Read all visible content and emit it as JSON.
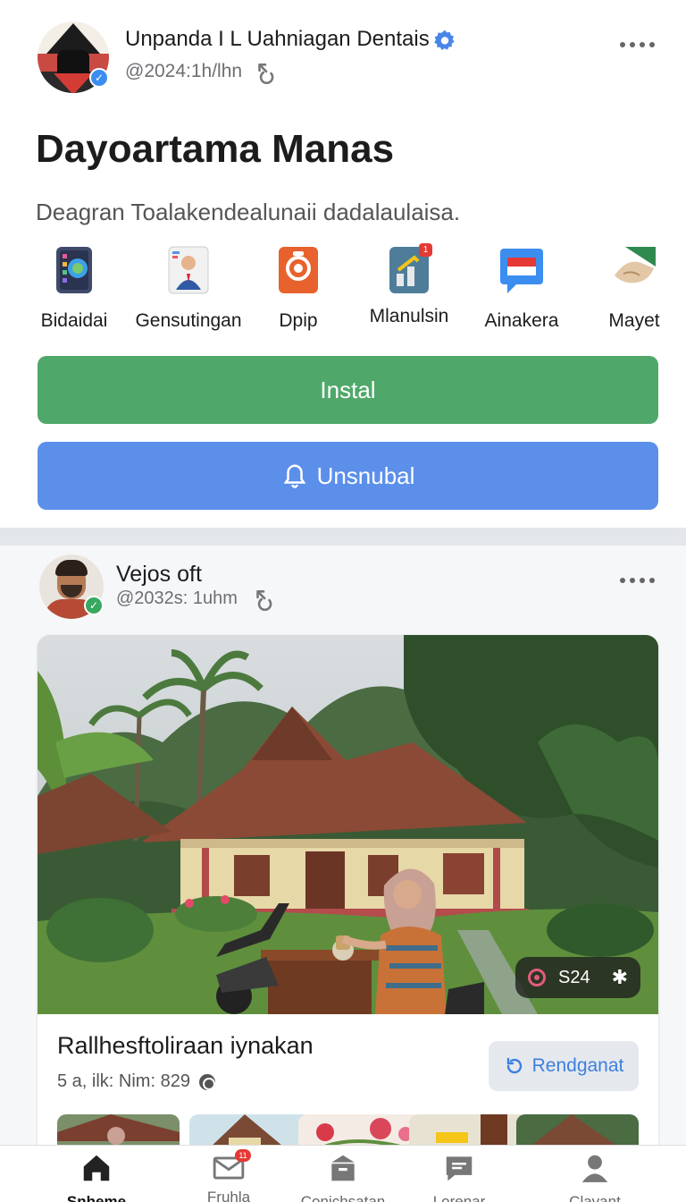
{
  "post1": {
    "author_name": "Unpanda I L Uahniagan Dentais",
    "handle": "@2024:1h/lhn",
    "title": "Dayoartama Manas",
    "description": "Deagran Toalakendealunaii dadalaulaisa.",
    "apps": [
      {
        "label": "Bidaidai",
        "icon": "tablet-app-icon"
      },
      {
        "label": "Gensutingan",
        "icon": "person-card-icon"
      },
      {
        "label": "Dpip",
        "icon": "camera-app-icon"
      },
      {
        "label": "Mlanulsin",
        "icon": "chart-app-icon",
        "badge": "1"
      },
      {
        "label": "Ainakera",
        "icon": "flag-chat-icon"
      },
      {
        "label": "Mayet",
        "icon": "handshake-icon"
      }
    ],
    "install_label": "Instal",
    "unsub_label": "Unsnubal"
  },
  "post2": {
    "author_name": "Vejos oft",
    "handle": "@2032s:  1uhm",
    "card_title": "Rallhesftoliraan iynakan",
    "card_meta": "5 a, ilk: Nim: 829",
    "stats_count": "S24",
    "action_label": "Rendganat"
  },
  "nav": {
    "items": [
      {
        "label": "Snheme",
        "icon": "home-icon",
        "active": true
      },
      {
        "label": "Fruhla",
        "icon": "mail-icon",
        "badge": "11"
      },
      {
        "label": "Conichsatan",
        "icon": "archive-icon"
      },
      {
        "label": "Lorenar",
        "icon": "chat-icon"
      },
      {
        "label": "Clavant",
        "icon": "profile-icon"
      }
    ]
  },
  "colors": {
    "install": "#4fa86a",
    "unsub": "#5b8fea",
    "accent_link": "#3d7fe0",
    "badge": "#e53935"
  }
}
